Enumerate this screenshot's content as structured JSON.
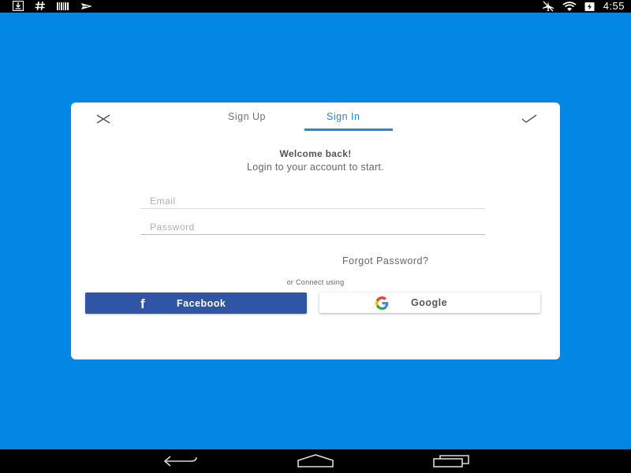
{
  "status_bar": {
    "time": "4:55",
    "left_icons": [
      "download-icon",
      "hash-icon",
      "barcode-icon",
      "airplane-notification-icon"
    ],
    "right_icons": [
      "airplane-mode-icon",
      "wifi-icon",
      "battery-charging-icon"
    ]
  },
  "dialog": {
    "tabs": [
      {
        "label": "Sign Up",
        "active": false
      },
      {
        "label": "Sign In",
        "active": true
      }
    ],
    "close_icon": "close-icon",
    "confirm_icon": "check-icon",
    "welcome_title": "Welcome back!",
    "welcome_subtitle": "Login to your account to start.",
    "email_placeholder": "Email",
    "password_placeholder": "Password",
    "forgot_password": "Forgot Password?",
    "or_connect": "or Connect using",
    "facebook_label": "Facebook",
    "google_label": "Google"
  },
  "nav_bar": {
    "icons": [
      "back-icon",
      "home-icon",
      "recents-icon"
    ]
  },
  "colors": {
    "background": "#0288e4",
    "accent": "#1e88e5",
    "facebook": "#2f55a4"
  }
}
